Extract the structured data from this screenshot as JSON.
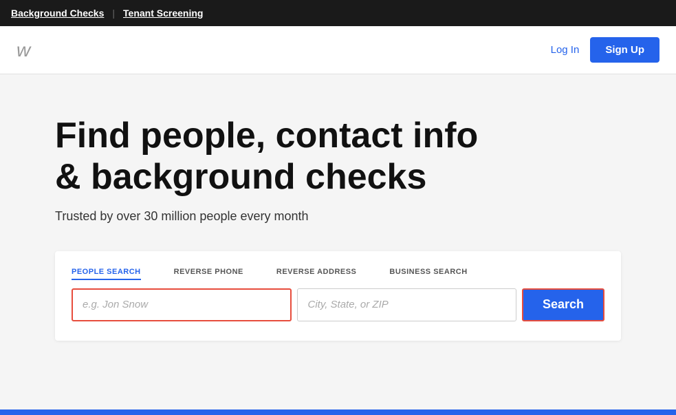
{
  "topnav": {
    "background_checks_label": "Background Checks",
    "tenant_screening_label": "Tenant Screening"
  },
  "header": {
    "logo_text": "w",
    "login_label": "Log In",
    "signup_label": "Sign Up"
  },
  "hero": {
    "title": "Find people, contact info & background checks",
    "subtitle": "Trusted by over 30 million people every month"
  },
  "search": {
    "tabs": [
      {
        "id": "people-search",
        "label": "PEOPLE SEARCH",
        "active": true
      },
      {
        "id": "reverse-phone",
        "label": "REVERSE PHONE",
        "active": false
      },
      {
        "id": "reverse-address",
        "label": "REVERSE ADDRESS",
        "active": false
      },
      {
        "id": "business-search",
        "label": "BUSINESS SEARCH",
        "active": false
      }
    ],
    "name_placeholder": "e.g. Jon Snow",
    "name_value": "",
    "location_placeholder": "City, State, or ZIP",
    "location_value": "",
    "search_button_label": "Search"
  }
}
